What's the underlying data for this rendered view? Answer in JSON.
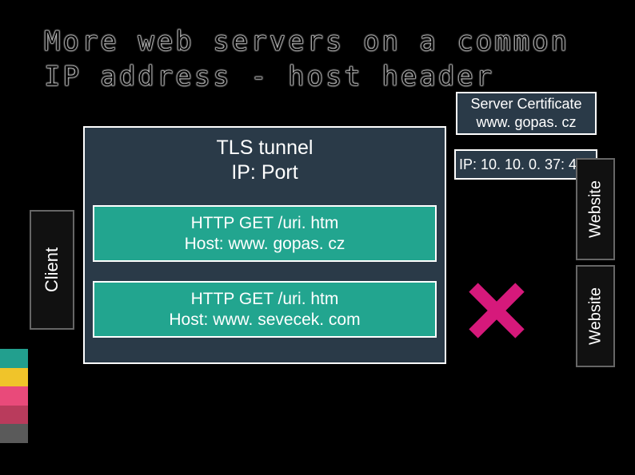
{
  "title": "More web servers on a common IP address - host header",
  "tunnel": {
    "line1": "TLS tunnel",
    "line2": "IP: Port"
  },
  "client": {
    "label": "Client"
  },
  "requests": [
    {
      "line1": "HTTP GET /uri. htm",
      "line2": "Host: www. gopas. cz"
    },
    {
      "line1": "HTTP GET /uri. htm",
      "line2": "Host: www. sevecek. com"
    }
  ],
  "cert": {
    "line1": "Server Certificate",
    "line2": "www. gopas. cz"
  },
  "server": {
    "ip": "IP: 10. 10. 0. 37: 443"
  },
  "websites": [
    {
      "label": "Website"
    },
    {
      "label": "Website"
    }
  ],
  "icons": {
    "reject": "cross-icon"
  }
}
